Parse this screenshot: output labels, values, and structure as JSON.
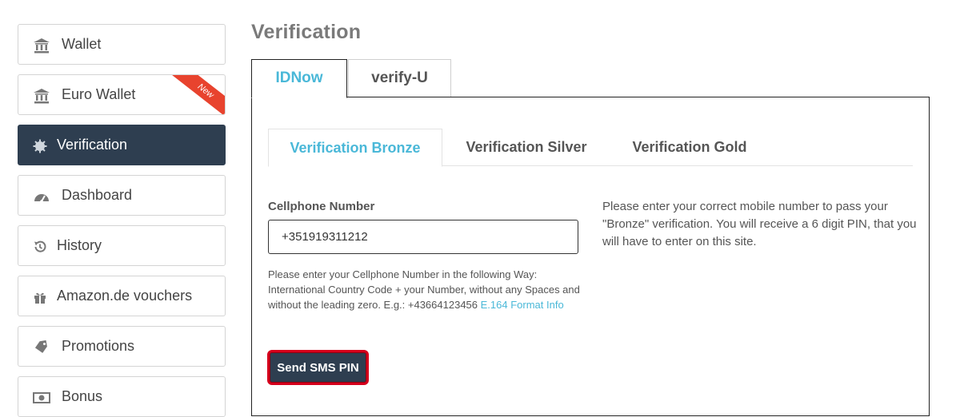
{
  "page": {
    "title": "Verification"
  },
  "sidebar": {
    "items": [
      {
        "label": "Wallet",
        "icon": "bank-icon"
      },
      {
        "label": "Euro Wallet",
        "icon": "bank-icon",
        "badge": "New"
      },
      {
        "label": "Verification",
        "icon": "gear-icon",
        "active": true
      },
      {
        "label": "Dashboard",
        "icon": "dashboard-icon"
      },
      {
        "label": "History",
        "icon": "history-icon"
      },
      {
        "label": "Amazon.de vouchers",
        "icon": "gift-icon"
      },
      {
        "label": "Promotions",
        "icon": "tag-icon"
      },
      {
        "label": "Bonus",
        "icon": "money-icon"
      }
    ]
  },
  "outer_tabs": [
    {
      "label": "IDNow",
      "active": true
    },
    {
      "label": "verify-U",
      "active": false
    }
  ],
  "inner_tabs": [
    {
      "label": "Verification Bronze",
      "active": true
    },
    {
      "label": "Verification Silver",
      "active": false
    },
    {
      "label": "Verification Gold",
      "active": false
    }
  ],
  "form": {
    "label": "Cellphone Number",
    "value": "+351919311212",
    "help": "Please enter your Cellphone Number in the following Way: International Country Code + your Number, without any Spaces and without the leading zero. E.g.: +43664123456",
    "help_link": "E.164 Format Info",
    "button": "Send SMS PIN"
  },
  "info": "Please enter your correct mobile number to pass your \"Bronze\" verification. You will receive a 6 digit PIN, that you will have to enter on this site.",
  "colors": {
    "accent": "#4ab8d8",
    "dark": "#2e3e50",
    "badge": "#e8432e",
    "highlight": "#d6001c"
  }
}
